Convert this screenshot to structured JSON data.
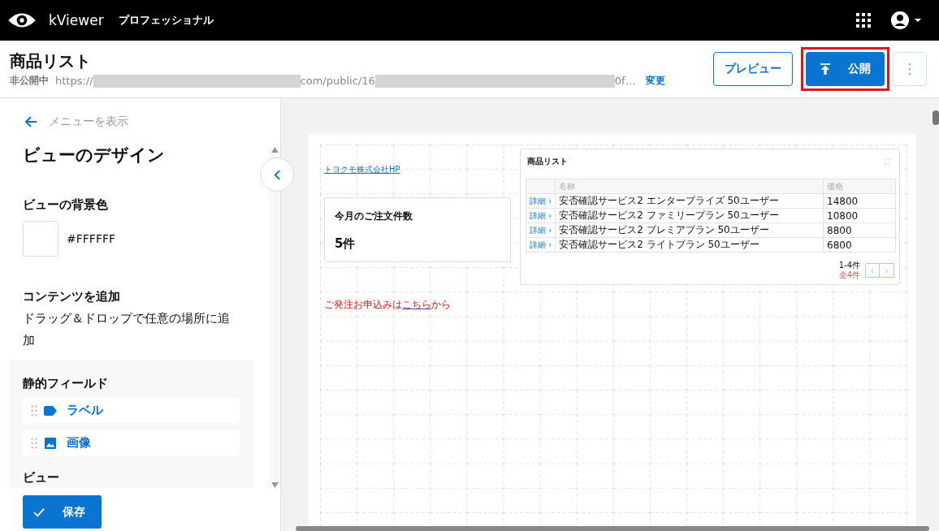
{
  "topbar": {
    "brand": "kViewer",
    "edition": "プロフェッショナル"
  },
  "header": {
    "title": "商品リスト",
    "status": "非公開中",
    "url_parts": [
      {
        "kind": "text",
        "text": "https://"
      },
      {
        "kind": "mask"
      },
      {
        "kind": "text",
        "text": "com/public/16"
      },
      {
        "kind": "mask"
      },
      {
        "kind": "text",
        "text": "0f…"
      }
    ],
    "change_link": "変更",
    "preview_button": "プレビュー",
    "publish_button": "公開",
    "publish_highlighted": true
  },
  "sidebar": {
    "back_link": "メニューを表示",
    "title": "ビューのデザイン",
    "bg_label": "ビューの背景色",
    "bg_value": "#FFFFFF",
    "add_title": "コンテンツを追加",
    "add_desc": "ドラッグ＆ドロップで任意の場所に追加",
    "static_title": "静的フィールド",
    "items": [
      {
        "kind": "label",
        "label": "ラベル"
      },
      {
        "kind": "image",
        "label": "画像"
      }
    ],
    "view_title": "ビュー",
    "save_button": "保存"
  },
  "canvas": {
    "link": "トヨクモ株式会社HP",
    "count_card": {
      "title": "今月のご注文件数",
      "value": "5件"
    },
    "order_text": {
      "before": "ご発注お申込みは",
      "link": "こちら",
      "after": "から"
    },
    "table_card": {
      "title": "商品リスト",
      "columns": [
        "名称",
        "価格"
      ],
      "rows": [
        {
          "detail_link": "詳細 ›",
          "name": "安否確認サービス2 エンタープライズ 50ユーザー",
          "price": "14800"
        },
        {
          "detail_link": "詳細 ›",
          "name": "安否確認サービス2 ファミリープラン 50ユーザー",
          "price": "10800"
        },
        {
          "detail_link": "詳細 ›",
          "name": "安否確認サービス2 プレミアプラン 50ユーザー",
          "price": "8800"
        },
        {
          "detail_link": "詳細 ›",
          "name": "安否確認サービス2 ライトプラン 50ユーザー",
          "price": "6800"
        }
      ],
      "range": "1-4件",
      "total": "全4件",
      "prev": "‹",
      "next": "›"
    }
  }
}
